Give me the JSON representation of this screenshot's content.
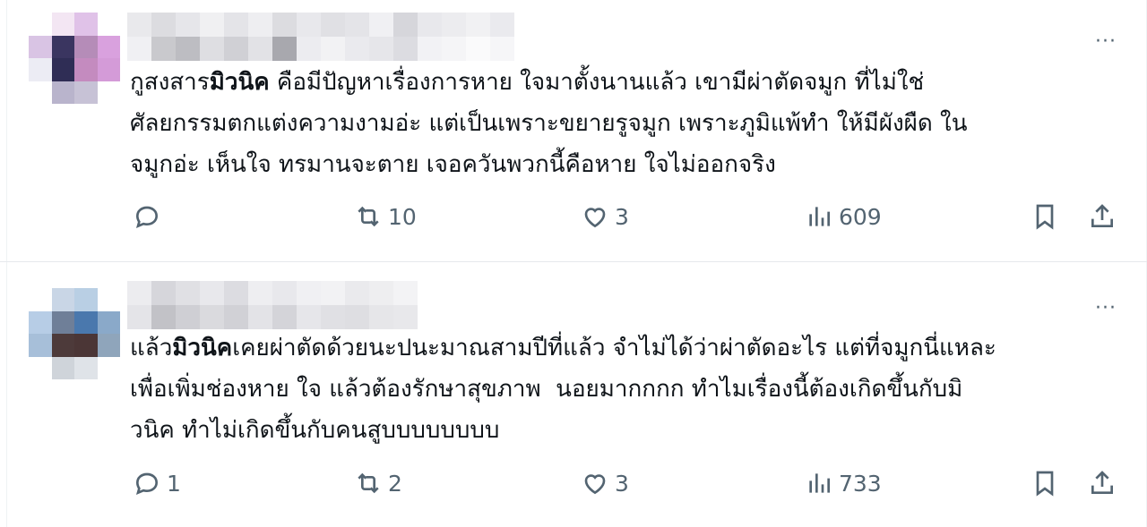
{
  "posts": [
    {
      "avatar_colors": [
        "#ffffff",
        "#f3e6f3",
        "#e0c2e8",
        "#ffffff",
        "#d9c4e4",
        "#3a3560",
        "#b58cb8",
        "#d9a1de",
        "#ececf4",
        "#2f2d55",
        "#c48bbf",
        "#d49bd8",
        "#ffffff",
        "#b9b4cc",
        "#c7c2d6",
        "#ffffff"
      ],
      "name_colors": [
        "#e9e9ec",
        "#f0f0f3",
        "#dcdce0",
        "#c9c9cd",
        "#e6e6ea",
        "#bdbdc2",
        "#f0f0f2",
        "#dedee2",
        "#e4e4e8",
        "#d0d0d5",
        "#eeeef1",
        "#e2e2e6",
        "#dcdce0",
        "#a8a8ae",
        "#e8e8ec",
        "#ececf0",
        "#e0e0e4",
        "#f2f2f4",
        "#e4e4e8",
        "#eaeaee",
        "#f0f0f3",
        "#e6e6ea",
        "#d6d6db",
        "#dcdce1",
        "#e8e8ec",
        "#f2f2f5",
        "#ececef",
        "#f5f5f7",
        "#f1f1f3",
        "#fafafb",
        "#eaeaee",
        "#f6f6f8"
      ],
      "text_before": "กูสงสาร",
      "text_bold": "มิวนิค",
      "text_after": " คือมีปัญหาเรื่องการหาย ใจมาตั้งนานแล้ว เขามีผ่าตัดจมูก ที่ไม่ใช่\nศัลยกรรมตกแต่งความงามอ่ะ แต่เป็นเพราะขยายรูจมูก เพราะภูมิแพ้ทำ ให้มีผังผืด ใน\nจมูกอ่ะ เห็นใจ ทรมานจะตาย เจอควันพวกนี้คือหาย ใจไม่ออกจริง",
      "reply_count": "",
      "repost_count": "10",
      "like_count": "3",
      "view_count": "609",
      "more_label": "···"
    },
    {
      "avatar_colors": [
        "#ffffff",
        "#c9d6e6",
        "#b9cfe4",
        "#ffffff",
        "#b7cde6",
        "#6f7f98",
        "#4a78ad",
        "#8aa9c9",
        "#a7bfd9",
        "#4d3a3a",
        "#4b3636",
        "#8fa5bb",
        "#ffffff",
        "#cfd4da",
        "#dfe3e8",
        "#ffffff"
      ],
      "name_colors": [
        "#ececef",
        "#e4e4e8",
        "#d6d6db",
        "#c2c2c7",
        "#e0e0e4",
        "#cfcfd4",
        "#e8e8ec",
        "#dadade",
        "#dcdce1",
        "#d1d1d6",
        "#eeeef1",
        "#e3e3e7",
        "#e8e8ec",
        "#d4d4d9",
        "#f0f0f3",
        "#e6e6ea",
        "#f2f2f4",
        "#e0e0e4",
        "#eaeaed",
        "#dedee2",
        "#eeeef0",
        "#e6e6e9",
        "#f3f3f5",
        "#e8e8eb"
      ],
      "text_before": "แล้ว",
      "text_bold": "มิวนิค",
      "text_after": "เคยผ่าตัดด้วยนะปนะมาณสามปีที่แล้ว จำไม่ได้ว่าผ่าตัดอะไร แต่ที่จมูกนี่แหละ\nเพื่อเพิ่มช่องหาย ใจ แล้วต้องรักษาสุขภาพ  นอยมากกกก ทำไมเรื่องนี้ต้องเกิดขึ้นกับมิ\nวนิค ทำไม่เกิดขึ้นกับคนสูบบบบบบบบ",
      "reply_count": "1",
      "repost_count": "2",
      "like_count": "3",
      "view_count": "733",
      "more_label": "···"
    }
  ]
}
